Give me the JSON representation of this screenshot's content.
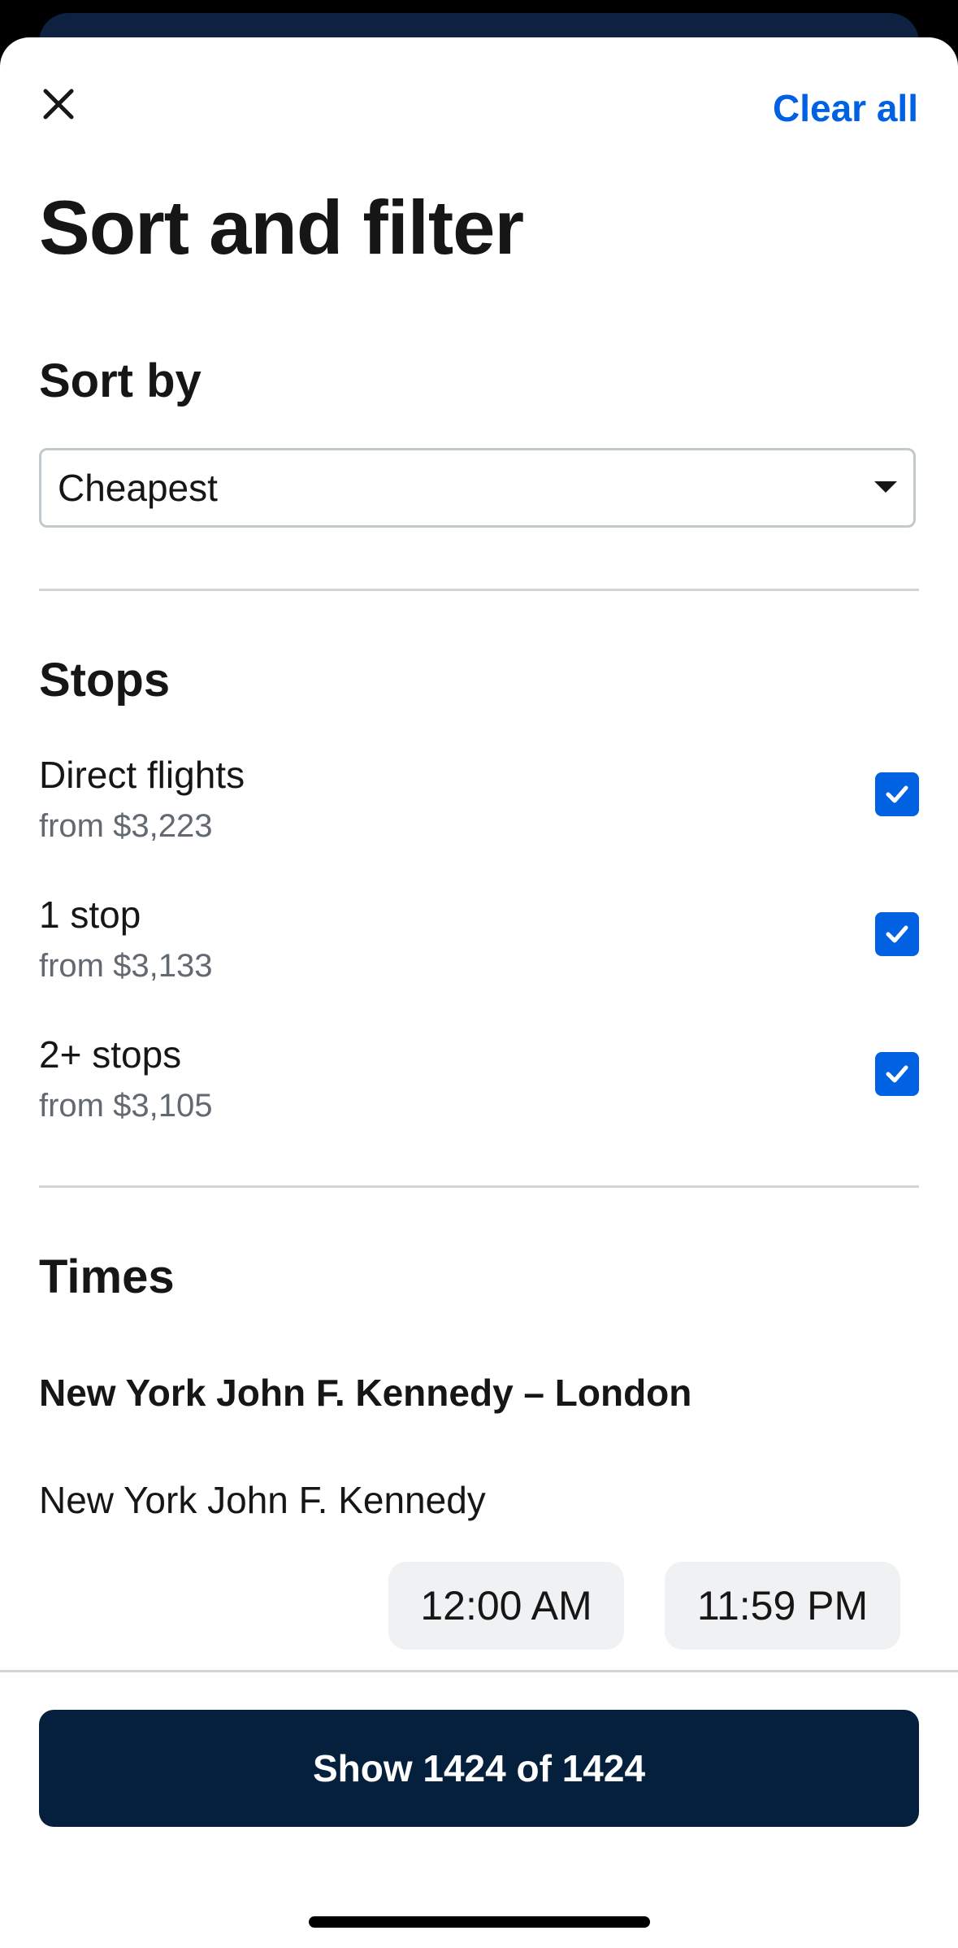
{
  "header": {
    "close_icon": "close-icon",
    "clear_all_label": "Clear all",
    "title": "Sort and filter"
  },
  "sort": {
    "heading": "Sort by",
    "selected": "Cheapest"
  },
  "stops": {
    "heading": "Stops",
    "items": [
      {
        "label": "Direct flights",
        "price": "from $3,223",
        "checked": true
      },
      {
        "label": "1 stop",
        "price": "from $3,133",
        "checked": true
      },
      {
        "label": "2+ stops",
        "price": "from $3,105",
        "checked": true
      }
    ]
  },
  "times": {
    "heading": "Times",
    "route": "New York John F. Kennedy – London",
    "origin_label": "New York John F. Kennedy",
    "start_time": "12:00 AM",
    "end_time": "11:59 PM"
  },
  "footer": {
    "show_label": "Show 1424 of 1424"
  },
  "colors": {
    "accent": "#0062e3",
    "button_bg": "#05203c",
    "muted_text": "#626971"
  }
}
